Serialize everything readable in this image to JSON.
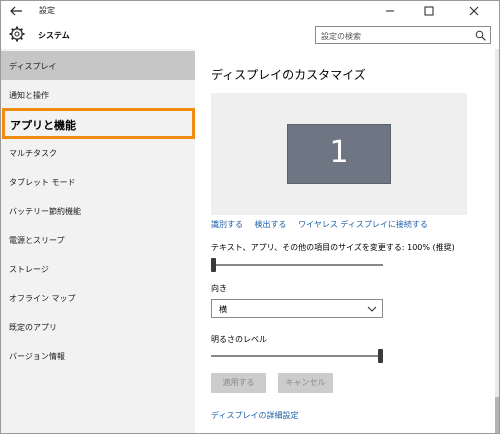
{
  "window": {
    "title": "設定"
  },
  "header": {
    "app_title": "システム",
    "search_placeholder": "設定の検索"
  },
  "sidebar": {
    "items": [
      {
        "label": "ディスプレイ"
      },
      {
        "label": "通知と操作"
      },
      {
        "label": "アプリと機能"
      },
      {
        "label": "マルチタスク"
      },
      {
        "label": "タブレット モード"
      },
      {
        "label": "バッテリー節約機能"
      },
      {
        "label": "電源とスリープ"
      },
      {
        "label": "ストレージ"
      },
      {
        "label": "オフライン マップ"
      },
      {
        "label": "既定のアプリ"
      },
      {
        "label": "バージョン情報"
      }
    ]
  },
  "main": {
    "title": "ディスプレイのカスタマイズ",
    "monitor_number": "1",
    "links": {
      "identify": "識別する",
      "detect": "検出する",
      "wireless": "ワイヤレス ディスプレイに接続する"
    },
    "scale": {
      "label": "テキスト、アプリ、その他の項目のサイズを変更する: 100% (推奨)",
      "value_fraction": 0.0
    },
    "orientation": {
      "label": "向き",
      "value": "横"
    },
    "brightness": {
      "label": "明るさのレベル",
      "value_fraction": 1.0
    },
    "buttons": {
      "apply": "適用する",
      "cancel": "キャンセル"
    },
    "advanced_link": "ディスプレイの詳細設定"
  },
  "colors": {
    "accent": "#1a5ea8",
    "highlight_border": "#f08c12",
    "selected_bg": "#c6c6c6",
    "sidebar_bg": "#f2f2f2"
  }
}
